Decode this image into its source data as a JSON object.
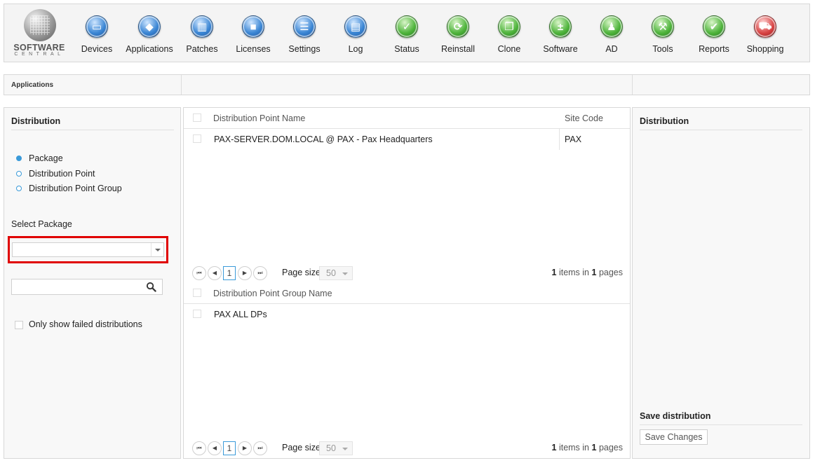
{
  "app": {
    "logo_line1": "SOFTWARE",
    "logo_line2": "CENTRAL"
  },
  "nav": [
    {
      "label": "Devices",
      "icon": "monitor-icon",
      "color": "blue"
    },
    {
      "label": "Applications",
      "icon": "applications-icon",
      "color": "blue"
    },
    {
      "label": "Patches",
      "icon": "book-icon",
      "color": "blue"
    },
    {
      "label": "Licenses",
      "icon": "folder-icon",
      "color": "blue"
    },
    {
      "label": "Settings",
      "icon": "settings-icon",
      "color": "blue"
    },
    {
      "label": "Log",
      "icon": "log-book-icon",
      "color": "blue"
    },
    {
      "label": "Status",
      "icon": "checkmark-icon",
      "color": "green"
    },
    {
      "label": "Reinstall",
      "icon": "refresh-icon",
      "color": "green"
    },
    {
      "label": "Clone",
      "icon": "copy-icon",
      "color": "green"
    },
    {
      "label": "Software",
      "icon": "plus-minus-icon",
      "color": "green"
    },
    {
      "label": "AD",
      "icon": "users-icon",
      "color": "green"
    },
    {
      "label": "Tools",
      "icon": "wrench-icon",
      "color": "green"
    },
    {
      "label": "Reports",
      "icon": "clipboard-icon",
      "color": "green"
    },
    {
      "label": "Shopping",
      "icon": "shopping-cart-icon",
      "color": "red"
    }
  ],
  "breadcrumb": "Applications",
  "left": {
    "title": "Distribution",
    "options": [
      {
        "label": "Package",
        "selected": true
      },
      {
        "label": "Distribution Point",
        "selected": false
      },
      {
        "label": "Distribution Point Group",
        "selected": false
      }
    ],
    "select_package_label": "Select Package",
    "select_package_value": "",
    "search_value": "",
    "failed_only_label": "Only show failed distributions"
  },
  "dp_grid": {
    "col_name": "Distribution Point Name",
    "col_site": "Site Code",
    "rows": [
      {
        "name": "PAX-SERVER.DOM.LOCAL @ PAX - Pax Headquarters",
        "site": "PAX"
      }
    ],
    "page": "1",
    "page_size_label": "Page size:",
    "page_size": "50",
    "items": "1",
    "items_text": "items in",
    "pages": "1",
    "pages_text": "pages"
  },
  "dpg_grid": {
    "col_name": "Distribution Point Group Name",
    "rows": [
      {
        "name": "PAX ALL DPs"
      }
    ],
    "page": "1",
    "page_size_label": "Page size:",
    "page_size": "50",
    "items": "1",
    "items_text": "items in",
    "pages": "1",
    "pages_text": "pages"
  },
  "right": {
    "title": "Distribution",
    "save_title": "Save distribution",
    "save_button": "Save Changes"
  },
  "colors": {
    "accent": "#3a9ad9",
    "highlight": "#e00000"
  }
}
